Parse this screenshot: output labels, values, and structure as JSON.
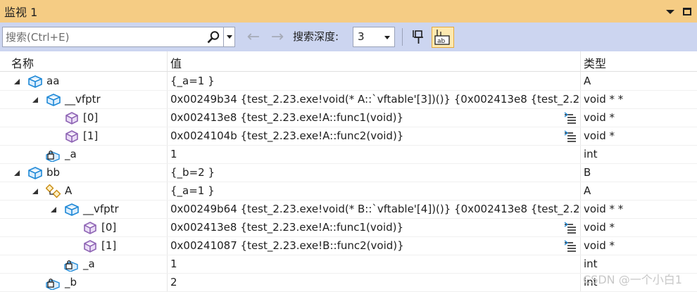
{
  "window": {
    "title": "监视 1"
  },
  "toolbar": {
    "search_placeholder": "搜索(Ctrl+E)",
    "back_arrow": "←",
    "forward_arrow": "→",
    "depth_label": "搜索深度:",
    "depth_value": "3"
  },
  "columns": {
    "name": "名称",
    "value": "值",
    "type": "类型"
  },
  "rows": [
    {
      "name": "aa",
      "value": "{_a=1 }",
      "type": "A",
      "icon": "object-icon",
      "expanded": true
    },
    {
      "name": "__vfptr",
      "value": "0x00249b34 {test_2.23.exe!void(* A::`vftable'[3])()} {0x002413e8 {test_2.2...",
      "type": "void * *",
      "icon": "object-icon",
      "expanded": true
    },
    {
      "name": "[0]",
      "value": "0x002413e8 {test_2.23.exe!A::func1(void)}",
      "type": "void *",
      "icon": "method-icon"
    },
    {
      "name": "[1]",
      "value": "0x0024104b {test_2.23.exe!A::func2(void)}",
      "type": "void *",
      "icon": "method-icon"
    },
    {
      "name": "_a",
      "value": "1",
      "type": "int",
      "icon": "private-field-icon"
    },
    {
      "name": "bb",
      "value": "{_b=2 }",
      "type": "B",
      "icon": "object-icon",
      "expanded": true
    },
    {
      "name": "A",
      "value": "{_a=1 }",
      "type": "A",
      "icon": "base-class-icon",
      "expanded": true
    },
    {
      "name": "__vfptr",
      "value": "0x00249b64 {test_2.23.exe!void(* B::`vftable'[4])()} {0x002413e8 {test_2.2...",
      "type": "void * *",
      "icon": "object-icon",
      "expanded": true
    },
    {
      "name": "[0]",
      "value": "0x002413e8 {test_2.23.exe!A::func1(void)}",
      "type": "void *",
      "icon": "method-icon"
    },
    {
      "name": "[1]",
      "value": "0x00241087 {test_2.23.exe!B::func2(void)}",
      "type": "void *",
      "icon": "method-icon"
    },
    {
      "name": "_a",
      "value": "1",
      "type": "int",
      "icon": "private-field-icon"
    },
    {
      "name": "_b",
      "value": "2",
      "type": "int",
      "icon": "private-field-icon"
    }
  ],
  "watermark": "CSDN @一个小白1",
  "colors": {
    "title_bar": "#f5cc84",
    "toolbar": "#ccd5f0",
    "object_icon": "#1e88d6",
    "method_icon": "#8e64b4",
    "selected_button": "#fde9b0"
  }
}
